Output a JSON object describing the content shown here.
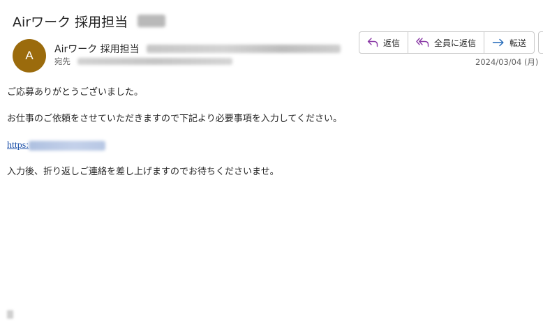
{
  "email": {
    "subject": "Airワーク 採用担当",
    "sender": {
      "avatar_initial": "A",
      "name": "Airワーク 採用担当"
    },
    "to_label": "宛先",
    "date": "2024/03/04 (月) ",
    "actions": {
      "reply": "返信",
      "reply_all": "全員に返信",
      "forward": "転送"
    },
    "body": {
      "line1": "ご応募ありがとうございました。",
      "line2": "お仕事のご依頼をさせていただきますので下記より必要事項を入力してください。",
      "link_text": "https:",
      "line3": "入力後、折り返しご連絡を差し上げますのでお待ちくださいませ。"
    }
  },
  "colors": {
    "avatar_bg": "#9b6b0c",
    "reply_icon": "#8a3aa6",
    "forward_icon": "#1f67b8",
    "link": "#1a4fa8"
  },
  "icons": [
    "reply-icon",
    "reply-all-icon",
    "forward-icon"
  ]
}
